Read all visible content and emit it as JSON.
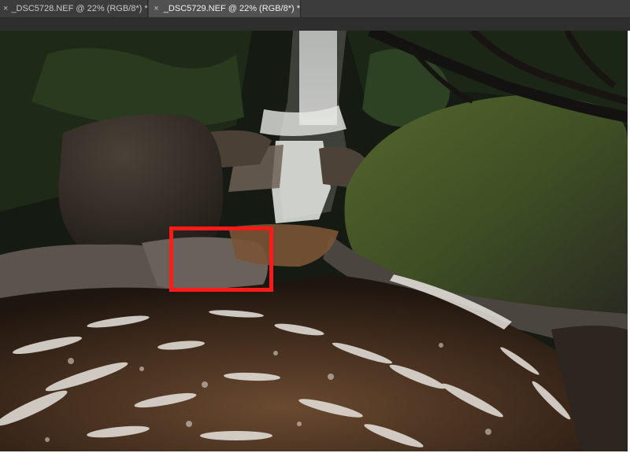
{
  "tabs": [
    {
      "label": "_DSC5728.NEF @ 22% (RGB/8*) *",
      "active": false,
      "close_glyph": "×"
    },
    {
      "label": "_DSC5729.NEF @ 22% (RGB/8*) *",
      "active": true,
      "close_glyph": "×"
    }
  ],
  "canvas": {
    "content": "landscape photo: waterfall, mossy boulders, foamy stream",
    "selection_color": "#ff1a1a"
  }
}
